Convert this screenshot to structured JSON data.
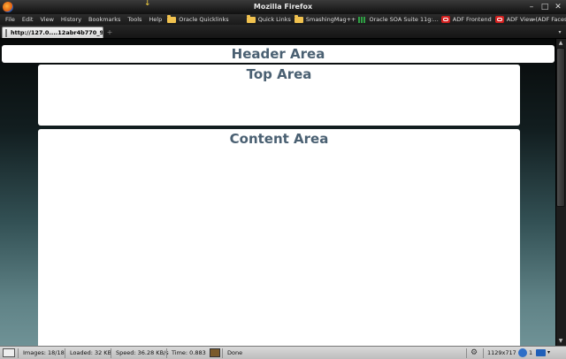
{
  "window": {
    "title": "Mozilla Firefox",
    "controls": [
      "–",
      "□",
      "✕"
    ]
  },
  "menu": [
    "File",
    "Edit",
    "View",
    "History",
    "Bookmarks",
    "Tools",
    "Help"
  ],
  "bookmarks": [
    {
      "label": "Oracle Quicklinks",
      "icon": "folder-icon"
    },
    {
      "label": "Quick Links",
      "icon": "folder-icon"
    },
    {
      "label": "SmashingMag++",
      "icon": "folder-icon"
    },
    {
      "label": "Oracle SOA Suite 11g:...",
      "icon": "bars-icon"
    },
    {
      "label": "ADF Frontend",
      "icon": "oracle-icon"
    },
    {
      "label": "ADF View (ADF Faces ...",
      "icon": "oracle-icon"
    }
  ],
  "bookmarks_overflow": "»",
  "tab": {
    "label": "http://127.0....12abr4b770_9"
  },
  "page": {
    "header_area": "Header Area",
    "top_area": "Top Area",
    "content_area": "Content Area"
  },
  "status": {
    "images": "Images: 18/18",
    "loaded": "Loaded: 32 KB",
    "speed": "Speed: 36.28 KB/s",
    "time": "Time: 0.883",
    "done": "Done",
    "resolution": "1129x717",
    "badge_count": "1"
  },
  "colors": {
    "area_title": "#4a6072",
    "background_bottom": "#6f9296"
  }
}
